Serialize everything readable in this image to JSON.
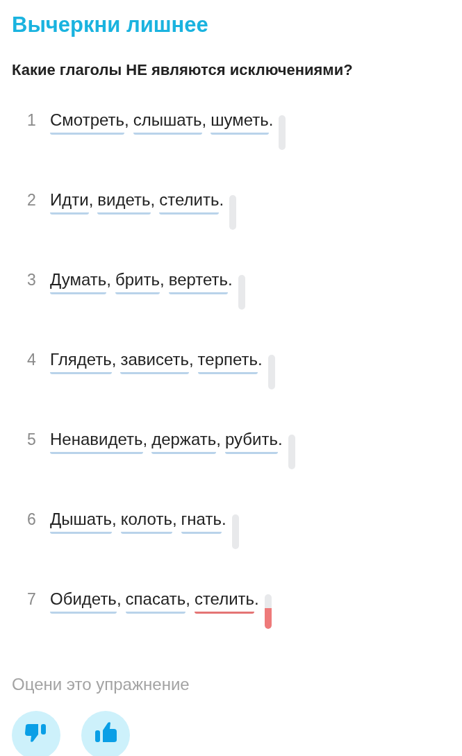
{
  "title": "Вычеркни лишнее",
  "question": "Какие глаголы НЕ являются исключениями?",
  "rows": [
    {
      "number": "1",
      "wrong": false,
      "words": [
        {
          "text": "Смотреть",
          "punct": ",",
          "wrong": false
        },
        {
          "text": "слышать",
          "punct": ",",
          "wrong": false
        },
        {
          "text": "шуметь",
          "punct": ".",
          "wrong": false
        }
      ]
    },
    {
      "number": "2",
      "wrong": false,
      "words": [
        {
          "text": "Идти",
          "punct": ",",
          "wrong": false
        },
        {
          "text": "видеть",
          "punct": ",",
          "wrong": false
        },
        {
          "text": "стелить",
          "punct": ".",
          "wrong": false
        }
      ]
    },
    {
      "number": "3",
      "wrong": false,
      "words": [
        {
          "text": "Думать",
          "punct": ",",
          "wrong": false
        },
        {
          "text": "брить",
          "punct": ",",
          "wrong": false
        },
        {
          "text": "вертеть",
          "punct": ".",
          "wrong": false
        }
      ]
    },
    {
      "number": "4",
      "wrong": false,
      "words": [
        {
          "text": "Глядеть",
          "punct": ",",
          "wrong": false
        },
        {
          "text": "зависеть",
          "punct": ",",
          "wrong": false
        },
        {
          "text": "терпеть",
          "punct": ".",
          "wrong": false
        }
      ]
    },
    {
      "number": "5",
      "wrong": false,
      "words": [
        {
          "text": "Ненавидеть",
          "punct": ",",
          "wrong": false
        },
        {
          "text": "держать",
          "punct": ",",
          "wrong": false
        },
        {
          "text": "рубить",
          "punct": ".",
          "wrong": false
        }
      ]
    },
    {
      "number": "6",
      "wrong": false,
      "words": [
        {
          "text": "Дышать",
          "punct": ",",
          "wrong": false
        },
        {
          "text": "колоть",
          "punct": ",",
          "wrong": false
        },
        {
          "text": "гнать",
          "punct": ".",
          "wrong": false
        }
      ]
    },
    {
      "number": "7",
      "wrong": true,
      "words": [
        {
          "text": "Обидеть",
          "punct": ",",
          "wrong": false
        },
        {
          "text": "спасать",
          "punct": ",",
          "wrong": false
        },
        {
          "text": "стелить",
          "punct": ".",
          "wrong": true
        }
      ]
    }
  ],
  "rating": {
    "label": "Оцени это упражнение"
  }
}
